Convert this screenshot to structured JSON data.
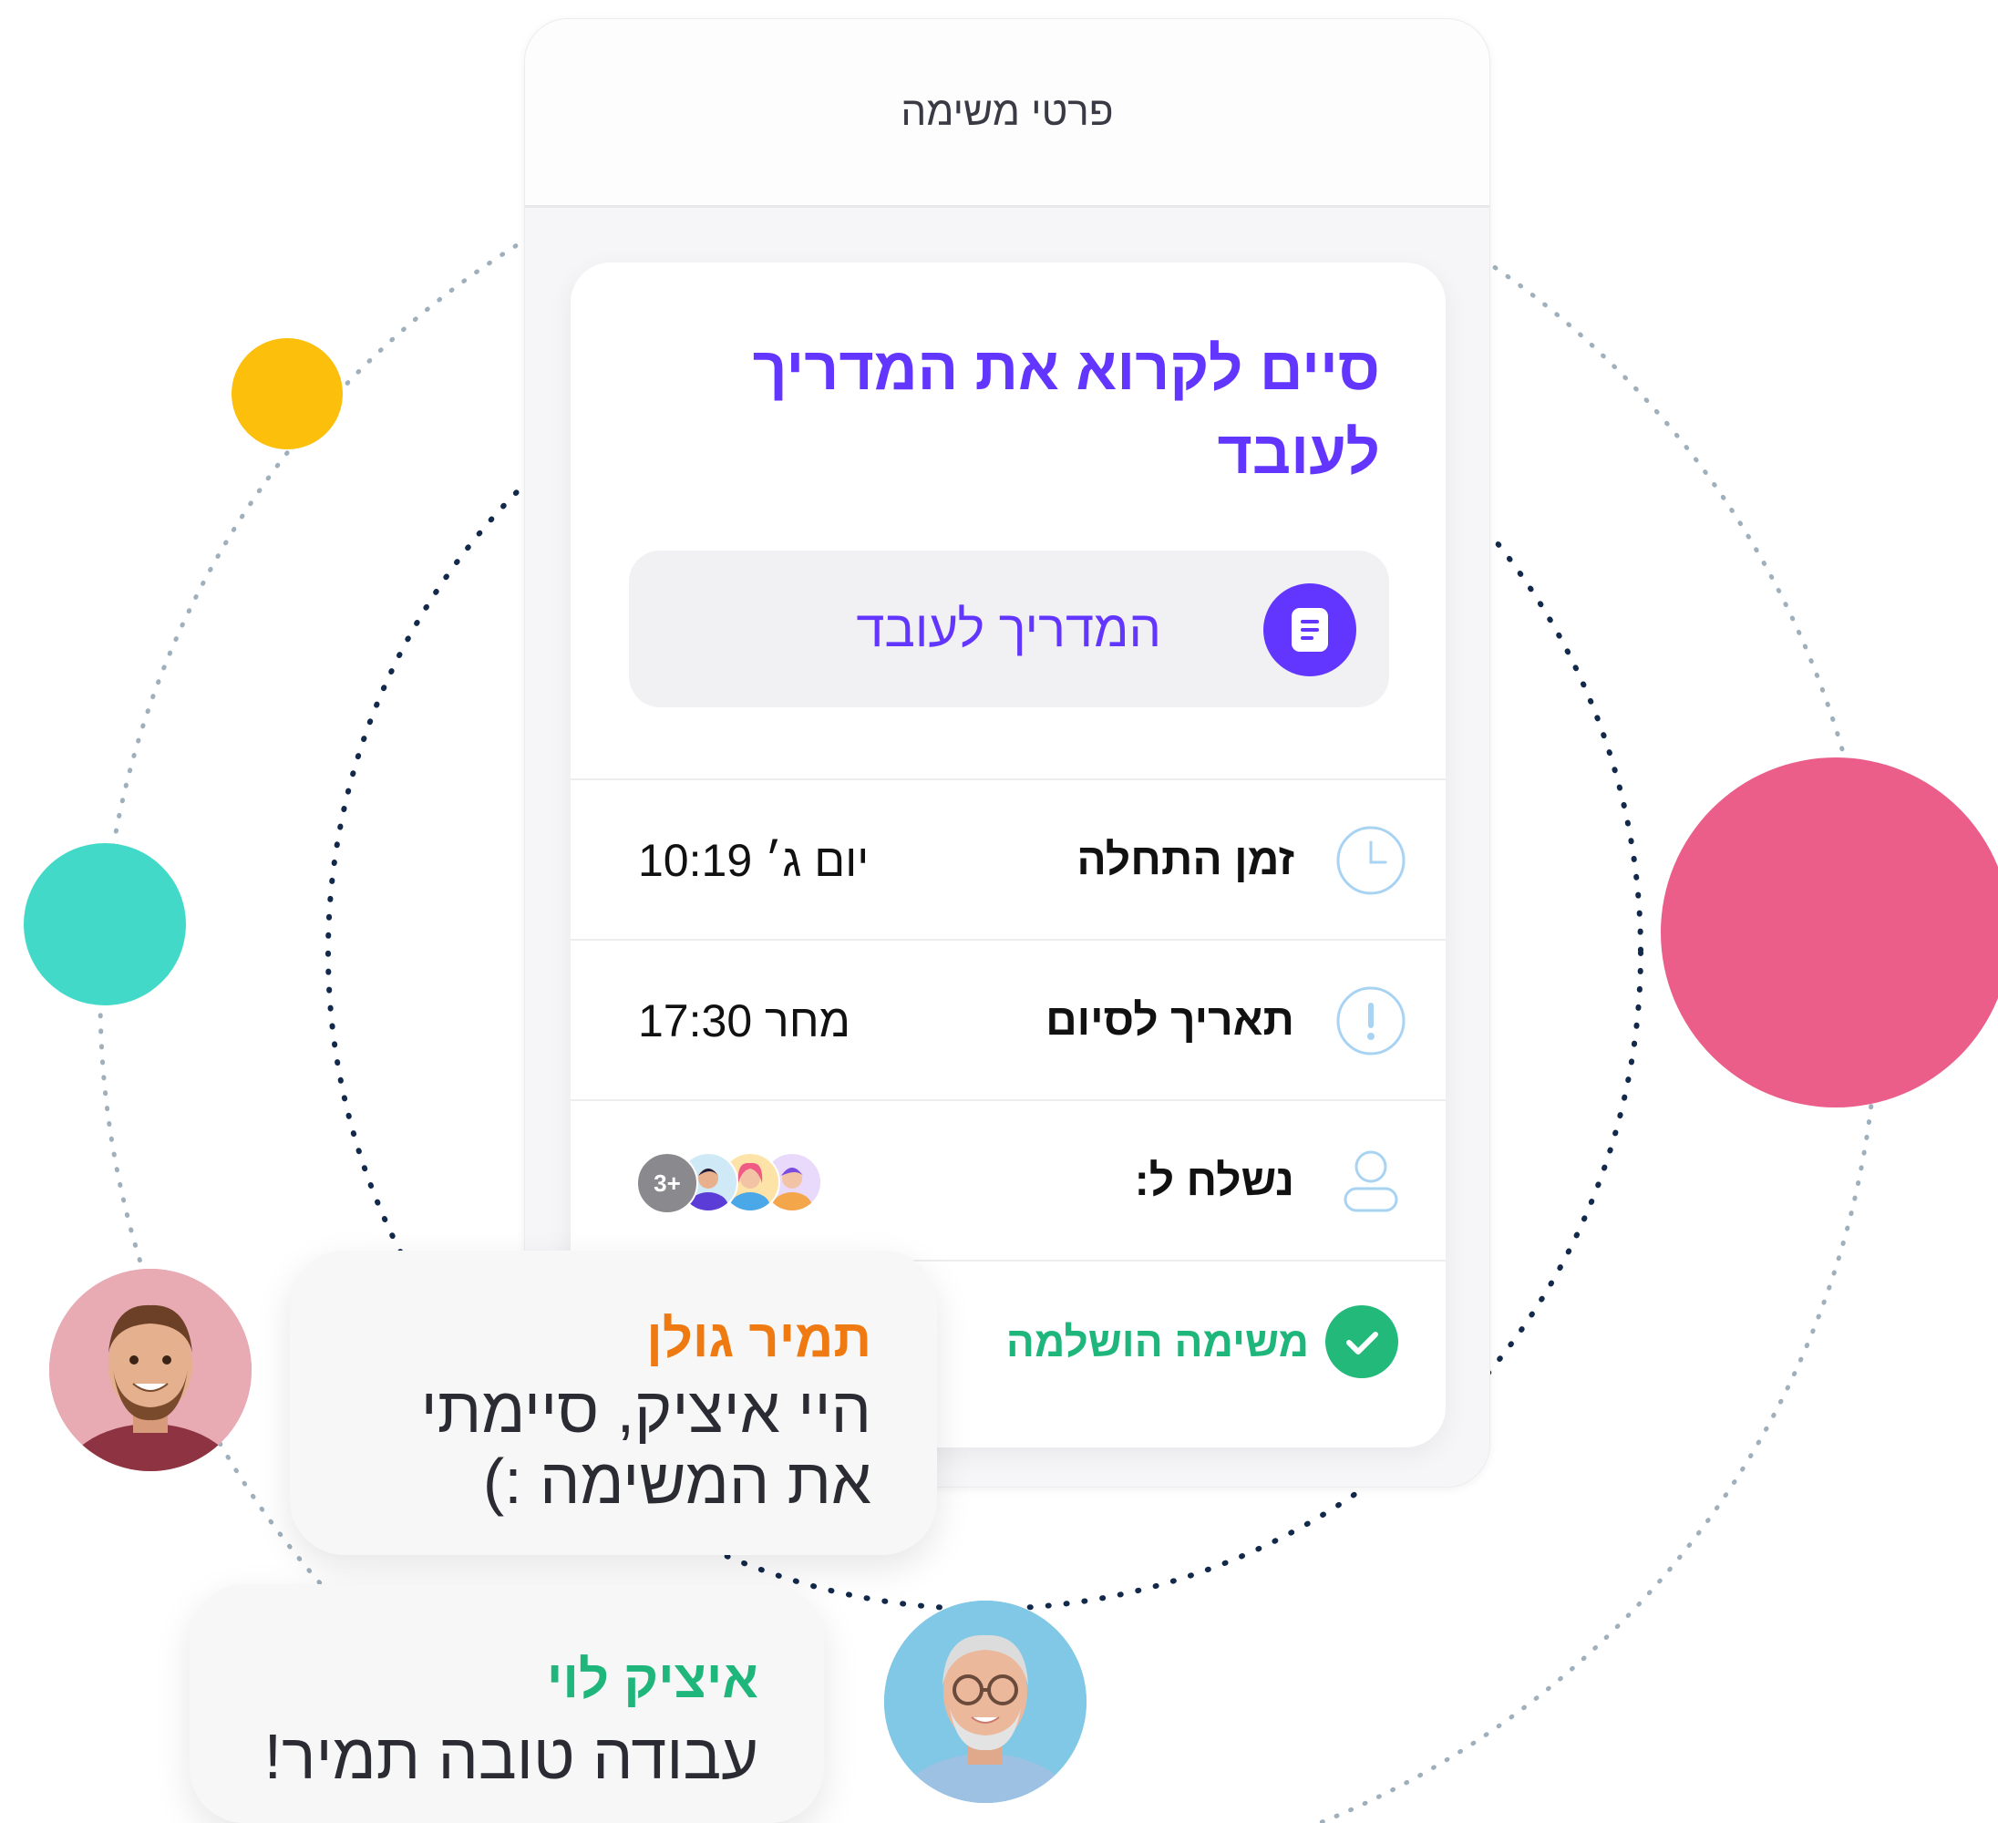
{
  "header": {
    "title": "פרטי משימה"
  },
  "task": {
    "title": "סיים לקרוא את המדריך לעובד",
    "attachment_label": "המדריך לעובד",
    "attachment_icon": "document-icon",
    "start_label": "זמן התחלה",
    "start_value": "יום ג׳ 10:19",
    "due_label": "תאריך לסיום",
    "due_value": "מחר 17:30",
    "sent_to_label": "נשלח ל:",
    "sent_to_more": "3+",
    "completed_label": "משימה הושלמה"
  },
  "chat": [
    {
      "name": "תמיר גולן",
      "text": "היי איציק, סיימתי את המשימה :)",
      "name_color": "#ef7a11"
    },
    {
      "name": "איציק לוי",
      "text": "עבודה טובה תמיר!",
      "name_color": "#1fb67c"
    }
  ],
  "colors": {
    "accent": "#6236ff",
    "success": "#22b97b",
    "yellow_dot": "#fcbf0c",
    "teal_dot": "#42d9c8",
    "pink_dot": "#eb5e8a"
  }
}
